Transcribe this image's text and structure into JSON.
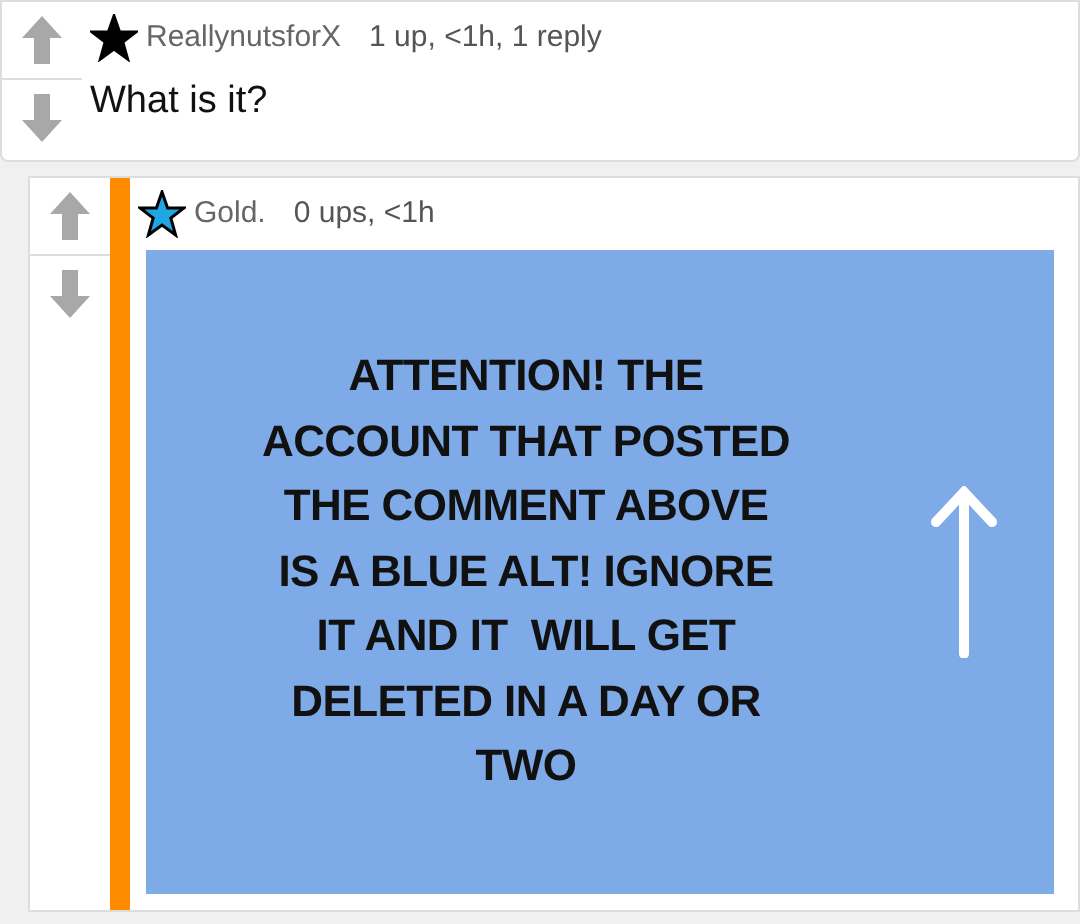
{
  "comments": [
    {
      "username": "ReallynutsforX",
      "meta": "1 up, <1h, 1 reply",
      "color": "#000000",
      "text": "What is it?"
    },
    {
      "username": "Gold.",
      "meta": "0 ups, <1h",
      "color": "#1ea7e0",
      "image": {
        "kind": "text-graphic",
        "lines": [
          "ATTENTION! THE",
          "ACCOUNT THAT POSTED",
          "THE COMMENT ABOVE",
          "IS A BLUE ALT! IGNORE",
          "IT AND IT  WILL GET",
          "DELETED IN A DAY OR",
          "TWO"
        ]
      }
    }
  ]
}
